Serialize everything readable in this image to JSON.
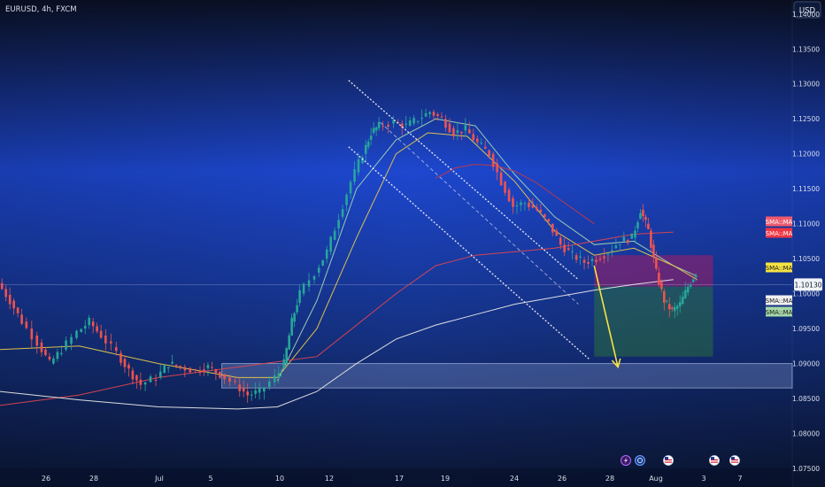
{
  "header": {
    "symbol_label": "EURUSD, 4h, FXCM"
  },
  "currency_button": "USD",
  "price_axis": {
    "ticks": [
      "1.14000",
      "1.13500",
      "1.13000",
      "1.12500",
      "1.12000",
      "1.11500",
      "1.11000",
      "1.10500",
      "1.10000",
      "1.09500",
      "1.09000",
      "1.08500",
      "1.08000",
      "1.07500"
    ],
    "current_price": "1.10130"
  },
  "time_axis": {
    "ticks": [
      "26",
      "28",
      "Jul",
      "5",
      "10",
      "12",
      "17",
      "19",
      "24",
      "26",
      "28",
      "Aug",
      "3",
      "7"
    ]
  },
  "ma_tags": [
    {
      "label": "SMA::MA",
      "color": "#ef5a6f",
      "text_color": "#ffffff"
    },
    {
      "label": "SMA::MA",
      "color": "#f23645",
      "text_color": "#ffffff"
    },
    {
      "label": "SMA::MA",
      "color": "#f5e342",
      "text_color": "#1a1a1a"
    },
    {
      "label": "SMA::MA",
      "color": "#f0f0f0",
      "text_color": "#1a1a1a"
    },
    {
      "label": "SMA::MA",
      "color": "#a5d6a7",
      "text_color": "#1a1a1a"
    }
  ],
  "event_icons": [
    "lightning-icon",
    "currency-icon",
    "us-flag-icon",
    "us-flag-icon",
    "us-flag-icon"
  ],
  "colors": {
    "bg_top": "#0a1024",
    "bg_mid": "#1b45cc",
    "bg_bottom": "#0b1633",
    "bull": "#26a69a",
    "bear": "#ef5350",
    "ma_fast": "#9fd3b2",
    "ma_yellow": "#e6c84a",
    "ma_red": "#e0444f",
    "ma_white": "#e8e8e8",
    "ma_darkred": "#c03a4a",
    "arrow": "#f5e342"
  },
  "chart_data": {
    "type": "candlestick",
    "title": "EURUSD, 4h, FXCM",
    "symbol": "EURUSD",
    "timeframe": "4h",
    "ylim": [
      1.075,
      1.142
    ],
    "x_ticks": [
      "26",
      "28",
      "Jul",
      "5",
      "10",
      "12",
      "17",
      "19",
      "24",
      "26",
      "28",
      "Aug",
      "3",
      "7"
    ],
    "y_ticks": [
      1.14,
      1.135,
      1.13,
      1.125,
      1.12,
      1.115,
      1.11,
      1.105,
      1.1,
      1.095,
      1.09,
      1.085,
      1.08,
      1.075
    ],
    "last_price": 1.1013,
    "price_path": [
      [
        0,
        1.1015
      ],
      [
        3,
        1.099
      ],
      [
        6,
        1.096
      ],
      [
        10,
        1.093
      ],
      [
        13,
        1.09
      ],
      [
        16,
        1.092
      ],
      [
        20,
        1.0945
      ],
      [
        23,
        1.096
      ],
      [
        26,
        1.094
      ],
      [
        30,
        1.0915
      ],
      [
        33,
        1.089
      ],
      [
        36,
        1.087
      ],
      [
        40,
        1.088
      ],
      [
        43,
        1.09
      ],
      [
        46,
        1.0895
      ],
      [
        50,
        1.089
      ],
      [
        53,
        1.0895
      ],
      [
        56,
        1.0885
      ],
      [
        60,
        1.087
      ],
      [
        63,
        1.0855
      ],
      [
        66,
        1.086
      ],
      [
        70,
        1.088
      ],
      [
        72,
        1.09
      ],
      [
        74,
        1.096
      ],
      [
        76,
        1.1
      ],
      [
        80,
        1.103
      ],
      [
        83,
        1.106
      ],
      [
        86,
        1.111
      ],
      [
        89,
        1.116
      ],
      [
        92,
        1.12
      ],
      [
        94,
        1.123
      ],
      [
        96,
        1.124
      ],
      [
        100,
        1.1245
      ],
      [
        103,
        1.124
      ],
      [
        106,
        1.125
      ],
      [
        109,
        1.126
      ],
      [
        112,
        1.125
      ],
      [
        115,
        1.123
      ],
      [
        118,
        1.1235
      ],
      [
        121,
        1.1215
      ],
      [
        124,
        1.12
      ],
      [
        127,
        1.116
      ],
      [
        130,
        1.1125
      ],
      [
        133,
        1.113
      ],
      [
        136,
        1.112
      ],
      [
        139,
        1.11
      ],
      [
        142,
        1.107
      ],
      [
        145,
        1.1055
      ],
      [
        148,
        1.1045
      ],
      [
        151,
        1.105
      ],
      [
        154,
        1.106
      ],
      [
        157,
        1.1075
      ],
      [
        160,
        1.108
      ],
      [
        162,
        1.112
      ],
      [
        164,
        1.109
      ],
      [
        166,
        1.103
      ],
      [
        168,
        1.099
      ],
      [
        170,
        1.0975
      ],
      [
        172,
        1.0985
      ],
      [
        174,
        1.101
      ],
      [
        176,
        1.103
      ]
    ],
    "time_span": 200,
    "moving_averages": [
      {
        "color_key": "ma_fast",
        "points": [
          [
            70,
            1.0875
          ],
          [
            80,
            1.099
          ],
          [
            90,
            1.115
          ],
          [
            100,
            1.122
          ],
          [
            110,
            1.125
          ],
          [
            120,
            1.124
          ],
          [
            130,
            1.117
          ],
          [
            140,
            1.111
          ],
          [
            150,
            1.107
          ],
          [
            160,
            1.1075
          ],
          [
            170,
            1.104
          ],
          [
            176,
            1.1025
          ]
        ]
      },
      {
        "color_key": "ma_yellow",
        "points": [
          [
            0,
            1.092
          ],
          [
            20,
            1.0925
          ],
          [
            40,
            1.09
          ],
          [
            60,
            1.088
          ],
          [
            70,
            1.088
          ],
          [
            80,
            1.095
          ],
          [
            90,
            1.108
          ],
          [
            100,
            1.12
          ],
          [
            108,
            1.123
          ],
          [
            118,
            1.1225
          ],
          [
            130,
            1.116
          ],
          [
            140,
            1.109
          ],
          [
            150,
            1.1055
          ],
          [
            160,
            1.1065
          ],
          [
            170,
            1.104
          ],
          [
            176,
            1.102
          ]
        ]
      },
      {
        "color_key": "ma_red",
        "points": [
          [
            0,
            1.084
          ],
          [
            20,
            1.0855
          ],
          [
            40,
            1.088
          ],
          [
            60,
            1.0895
          ],
          [
            80,
            1.091
          ],
          [
            100,
            1.1
          ],
          [
            110,
            1.104
          ],
          [
            120,
            1.1055
          ],
          [
            130,
            1.106
          ],
          [
            140,
            1.1065
          ],
          [
            150,
            1.1075
          ],
          [
            160,
            1.1085
          ],
          [
            170,
            1.1088
          ]
        ]
      },
      {
        "color_key": "ma_white",
        "points": [
          [
            0,
            1.086
          ],
          [
            20,
            1.0848
          ],
          [
            40,
            1.0838
          ],
          [
            60,
            1.0835
          ],
          [
            70,
            1.0838
          ],
          [
            80,
            1.086
          ],
          [
            90,
            1.09
          ],
          [
            100,
            1.0935
          ],
          [
            110,
            1.0955
          ],
          [
            120,
            1.097
          ],
          [
            130,
            1.0985
          ],
          [
            140,
            1.0995
          ],
          [
            150,
            1.1005
          ],
          [
            160,
            1.1013
          ],
          [
            170,
            1.102
          ]
        ]
      },
      {
        "color_key": "ma_darkred",
        "points": [
          [
            110,
            1.1165
          ],
          [
            115,
            1.118
          ],
          [
            120,
            1.1185
          ],
          [
            125,
            1.1183
          ],
          [
            130,
            1.1175
          ],
          [
            135,
            1.116
          ],
          [
            140,
            1.114
          ],
          [
            145,
            1.112
          ],
          [
            150,
            1.11
          ]
        ]
      }
    ],
    "support_zone": {
      "from_time": 56,
      "y_low": 1.0865,
      "y_high": 1.09
    },
    "channel_upper": [
      [
        88,
        1.1305
      ],
      [
        146,
        1.102
      ]
    ],
    "channel_lower": [
      [
        88,
        1.121
      ],
      [
        149,
        1.0905
      ]
    ],
    "channel_mid": [
      [
        96,
        1.1245
      ],
      [
        146,
        1.0985
      ]
    ],
    "short_position": {
      "from_time": 150,
      "to_time": 180,
      "stop": 1.1055,
      "entry": 1.101,
      "target": 1.091
    },
    "projection_arrow": [
      [
        150,
        1.104
      ],
      [
        156,
        1.0895
      ]
    ]
  }
}
